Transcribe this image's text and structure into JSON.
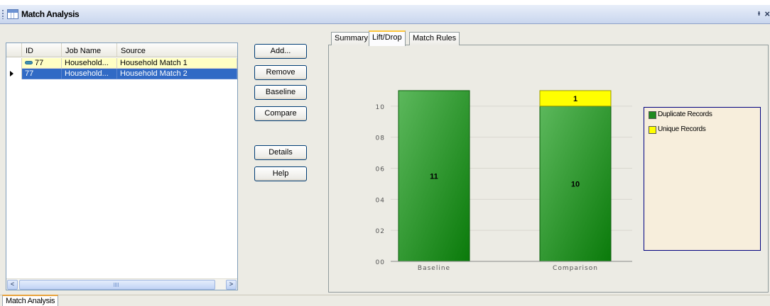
{
  "window": {
    "title": "Match Analysis",
    "pin_icon": "pin-icon",
    "close_icon": "close-icon"
  },
  "grid": {
    "columns": [
      "ID",
      "Job Name",
      "Source"
    ],
    "rows": [
      {
        "id": "77",
        "job_name": "Household...",
        "source": "Household Match 1",
        "icon": "link-icon",
        "selected": false
      },
      {
        "id": "77",
        "job_name": "Household...",
        "source": "Household Match 2",
        "icon": "row-indicator-arrow",
        "selected": true
      }
    ]
  },
  "buttons": {
    "add": "Add...",
    "remove": "Remove",
    "baseline": "Baseline",
    "compare": "Compare",
    "details": "Details",
    "help": "Help"
  },
  "tabs": [
    {
      "label": "Summary",
      "active": false
    },
    {
      "label": "Lift/Drop",
      "active": true
    },
    {
      "label": "Match Rules",
      "active": false
    }
  ],
  "chart_data": {
    "type": "bar",
    "stacked": true,
    "categories": [
      "Baseline",
      "Comparison"
    ],
    "series": [
      {
        "name": "Duplicate Records",
        "values": [
          11,
          10
        ],
        "color": "#1f8a1f"
      },
      {
        "name": "Unique Records",
        "values": [
          0,
          1
        ],
        "color": "#ffff00"
      }
    ],
    "data_labels": [
      {
        "category": "Baseline",
        "series": "Duplicate Records",
        "text": "11"
      },
      {
        "category": "Comparison",
        "series": "Duplicate Records",
        "text": "10"
      },
      {
        "category": "Comparison",
        "series": "Unique Records",
        "text": "1"
      }
    ],
    "y_tick_labels": [
      "00",
      "02",
      "04",
      "06",
      "08",
      "10"
    ],
    "y_tick_values": [
      0,
      2,
      4,
      6,
      8,
      10
    ],
    "ylim": [
      0,
      12
    ],
    "grid": true,
    "legend": "right"
  },
  "bottom_tab": {
    "label": "Match Analysis"
  }
}
